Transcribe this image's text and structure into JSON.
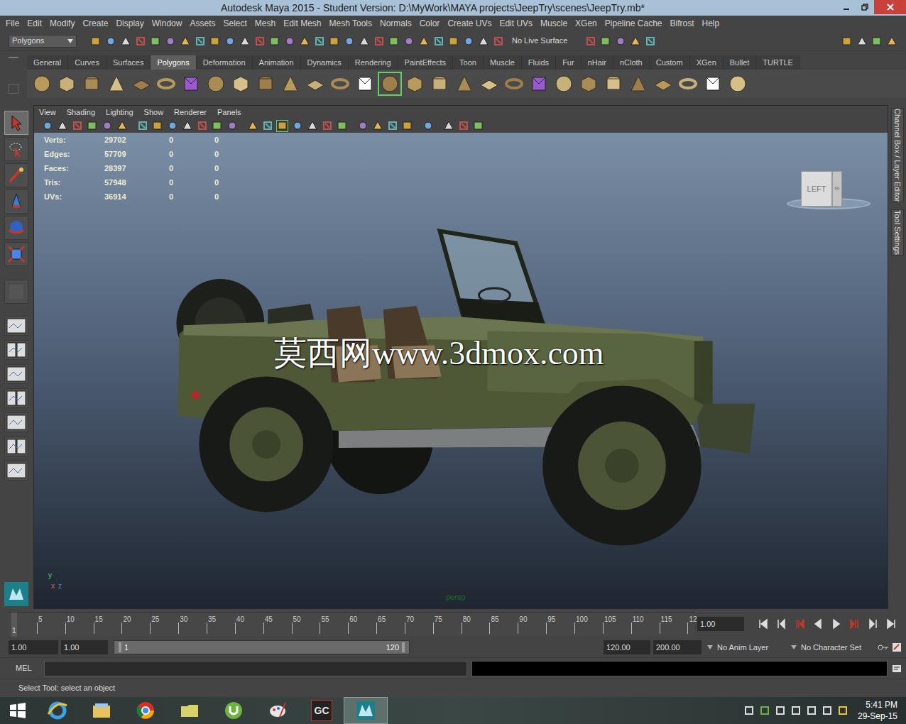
{
  "window": {
    "title": "Autodesk Maya 2015 - Student Version: D:\\MyWork\\MAYA projects\\JeepTry\\scenes\\JeepTry.mb*"
  },
  "menu": [
    "File",
    "Edit",
    "Modify",
    "Create",
    "Display",
    "Window",
    "Assets",
    "Select",
    "Mesh",
    "Edit Mesh",
    "Mesh Tools",
    "Normals",
    "Color",
    "Create UVs",
    "Edit UVs",
    "Muscle",
    "XGen",
    "Pipeline Cache",
    "Bifrost",
    "Help"
  ],
  "status_line": {
    "menu_set": "Polygons",
    "live_surface": "No Live Surface"
  },
  "shelf": {
    "tabs": [
      {
        "label": "General",
        "selected": false
      },
      {
        "label": "Curves",
        "selected": false
      },
      {
        "label": "Surfaces",
        "selected": false
      },
      {
        "label": "Polygons",
        "selected": true
      },
      {
        "label": "Deformation",
        "selected": false
      },
      {
        "label": "Animation",
        "selected": false
      },
      {
        "label": "Dynamics",
        "selected": false
      },
      {
        "label": "Rendering",
        "selected": false
      },
      {
        "label": "PaintEffects",
        "selected": false
      },
      {
        "label": "Toon",
        "selected": false
      },
      {
        "label": "Muscle",
        "selected": false
      },
      {
        "label": "Fluids",
        "selected": false
      },
      {
        "label": "Fur",
        "selected": false
      },
      {
        "label": "nHair",
        "selected": false
      },
      {
        "label": "nCloth",
        "selected": false
      },
      {
        "label": "Custom",
        "selected": false
      },
      {
        "label": "XGen",
        "selected": false
      },
      {
        "label": "Bullet",
        "selected": false
      },
      {
        "label": "TURTLE",
        "selected": false
      }
    ],
    "icons": [
      {
        "selected": false
      },
      {
        "selected": false
      },
      {
        "selected": false
      },
      {
        "selected": false
      },
      {
        "selected": false
      },
      {
        "selected": false
      },
      {
        "selected": false
      },
      {
        "selected": false
      },
      {
        "selected": false
      },
      {
        "selected": false
      },
      {
        "selected": false
      },
      {
        "selected": false
      },
      {
        "selected": false
      },
      {
        "selected": false
      },
      {
        "selected": true
      },
      {
        "selected": false
      },
      {
        "selected": false
      },
      {
        "selected": false
      },
      {
        "selected": false
      },
      {
        "selected": false
      },
      {
        "selected": false
      },
      {
        "selected": false
      },
      {
        "selected": false
      },
      {
        "selected": false
      },
      {
        "selected": false
      },
      {
        "selected": false
      },
      {
        "selected": false
      },
      {
        "selected": false
      },
      {
        "selected": false
      }
    ]
  },
  "toolbox": {
    "tools": [
      {
        "kind": "select",
        "selected": true
      },
      {
        "kind": "lasso",
        "selected": false
      },
      {
        "kind": "paint",
        "selected": false
      },
      {
        "kind": "move",
        "selected": false
      },
      {
        "kind": "rotate",
        "selected": false
      },
      {
        "kind": "scale",
        "selected": false
      },
      {
        "kind": "last",
        "selected": false
      }
    ]
  },
  "panel": {
    "menus": [
      "View",
      "Shading",
      "Lighting",
      "Show",
      "Renderer",
      "Panels"
    ],
    "icons": [
      {
        "selected": false
      },
      {
        "selected": false
      },
      {
        "selected": false
      },
      {
        "selected": false
      },
      {
        "selected": false
      },
      {
        "selected": false
      },
      {
        "selected": false
      },
      {
        "selected": false
      },
      {
        "selected": false
      },
      {
        "selected": false
      },
      {
        "selected": false
      },
      {
        "selected": false
      },
      {
        "selected": false
      },
      {
        "selected": false
      },
      {
        "selected": false
      },
      {
        "selected": true
      },
      {
        "selected": false
      },
      {
        "selected": false
      },
      {
        "selected": false
      },
      {
        "selected": false
      },
      {
        "selected": false
      },
      {
        "selected": false
      },
      {
        "selected": false
      },
      {
        "selected": false
      },
      {
        "selected": false
      },
      {
        "selected": false
      },
      {
        "selected": false
      },
      {
        "selected": false
      }
    ]
  },
  "hud": [
    {
      "label": "Verts:",
      "values": [
        "29702",
        "0",
        "0"
      ]
    },
    {
      "label": "Edges:",
      "values": [
        "57709",
        "0",
        "0"
      ]
    },
    {
      "label": "Faces:",
      "values": [
        "28397",
        "0",
        "0"
      ]
    },
    {
      "label": "Tris:",
      "values": [
        "57948",
        "0",
        "0"
      ]
    },
    {
      "label": "UVs:",
      "values": [
        "36914",
        "0",
        "0"
      ]
    }
  ],
  "viewcube": {
    "label": "LEFT",
    "side": "RI"
  },
  "watermark": "莫西网www.3dmox.com",
  "camera": "persp",
  "axis": [
    "y",
    "x",
    "z"
  ],
  "side_tabs": [
    "Channel Box / Layer Editor",
    "Tool Settings"
  ],
  "timeline": {
    "start": "1",
    "ticks": [
      "5",
      "10",
      "15",
      "20",
      "25",
      "30",
      "35",
      "40",
      "45",
      "50",
      "55",
      "60",
      "65",
      "70",
      "75",
      "80",
      "85",
      "90",
      "95",
      "100",
      "105",
      "110",
      "115",
      "12"
    ],
    "current_frame": "1.00"
  },
  "range": {
    "start": "1.00",
    "playback_start": "1.00",
    "slider_start": "1",
    "slider_end": "120",
    "playback_end": "120.00",
    "end": "200.00",
    "anim_layer": "No Anim Layer",
    "character_set": "No Character Set"
  },
  "command_line": {
    "language": "MEL"
  },
  "help_line": "Select Tool: select an object",
  "taskbar": {
    "apps": [
      {
        "kind": "ie",
        "label": "",
        "selected": false
      },
      {
        "kind": "explorer",
        "label": "",
        "selected": false
      },
      {
        "kind": "chrome",
        "label": "",
        "selected": false
      },
      {
        "kind": "folder",
        "label": "",
        "selected": false
      },
      {
        "kind": "utorrent",
        "label": "",
        "selected": false
      },
      {
        "kind": "paint",
        "label": "",
        "selected": false
      },
      {
        "kind": "gc",
        "label": "GC",
        "selected": false
      },
      {
        "kind": "maya",
        "label": "",
        "selected": true
      }
    ],
    "time": "5:41 PM",
    "date": "29-Sep-15"
  }
}
